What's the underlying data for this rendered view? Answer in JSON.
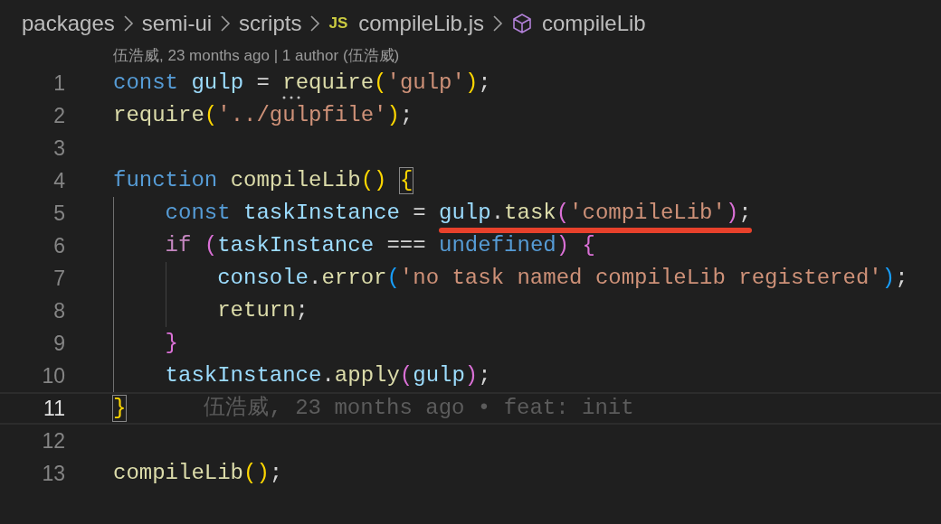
{
  "breadcrumbs": [
    {
      "label": "packages",
      "kind": "folder"
    },
    {
      "label": "semi-ui",
      "kind": "folder"
    },
    {
      "label": "scripts",
      "kind": "folder"
    },
    {
      "label": "compileLib.js",
      "kind": "file",
      "badge": "JS"
    },
    {
      "label": "compileLib",
      "kind": "symbol"
    }
  ],
  "codelens": "伍浩威, 23 months ago | 1 author (伍浩威)",
  "lines": [
    {
      "number": "1",
      "current": false,
      "tokens": [
        {
          "t": "const ",
          "color": "#569cd6"
        },
        {
          "t": "gulp",
          "color": "#9cdcfe"
        },
        {
          "t": " = ",
          "color": "#d4d4d4"
        },
        {
          "t": "require",
          "color": "#dcdcaa",
          "hint": true
        },
        {
          "t": "(",
          "color": "#ffd700"
        },
        {
          "t": "'gulp'",
          "color": "#ce9178"
        },
        {
          "t": ")",
          "color": "#ffd700"
        },
        {
          "t": ";",
          "color": "#d4d4d4"
        }
      ]
    },
    {
      "number": "2",
      "current": false,
      "tokens": [
        {
          "t": "require",
          "color": "#dcdcaa"
        },
        {
          "t": "(",
          "color": "#ffd700"
        },
        {
          "t": "'../gulpfile'",
          "color": "#ce9178"
        },
        {
          "t": ")",
          "color": "#ffd700"
        },
        {
          "t": ";",
          "color": "#d4d4d4"
        }
      ]
    },
    {
      "number": "3",
      "current": false
    },
    {
      "number": "4",
      "current": false,
      "tokens": [
        {
          "t": "function ",
          "color": "#569cd6"
        },
        {
          "t": "compileLib",
          "color": "#dcdcaa"
        },
        {
          "t": "() ",
          "color": "#ffd700"
        },
        {
          "t": "{",
          "color": "#ffd700",
          "matched": true
        }
      ],
      "children": [
        {
          "number": "5",
          "current": false,
          "tokens": [
            {
              "t": "const ",
              "color": "#569cd6"
            },
            {
              "t": "taskInstance",
              "color": "#9cdcfe"
            },
            {
              "t": " = ",
              "color": "#d4d4d4"
            },
            {
              "underlined": true,
              "tokens": [
                {
                  "t": "gulp",
                  "color": "#9cdcfe"
                },
                {
                  "t": ".",
                  "color": "#d4d4d4"
                },
                {
                  "t": "task",
                  "color": "#dcdcaa"
                },
                {
                  "t": "(",
                  "color": "#da70d6"
                },
                {
                  "t": "'compileLib'",
                  "color": "#ce9178"
                },
                {
                  "t": ")",
                  "color": "#da70d6"
                },
                {
                  "t": ";",
                  "color": "#d4d4d4"
                }
              ]
            }
          ]
        },
        {
          "number": "6",
          "current": false,
          "tokens": [
            {
              "t": "if ",
              "color": "#c586c0"
            },
            {
              "t": "(",
              "color": "#da70d6"
            },
            {
              "t": "taskInstance",
              "color": "#9cdcfe"
            },
            {
              "t": " === ",
              "color": "#d4d4d4"
            },
            {
              "t": "undefined",
              "color": "#569cd6"
            },
            {
              "t": ")",
              "color": "#da70d6"
            },
            {
              "t": " {",
              "color": "#da70d6"
            }
          ],
          "children": [
            {
              "number": "7",
              "current": false,
              "tokens": [
                {
                  "t": "console",
                  "color": "#9cdcfe"
                },
                {
                  "t": ".",
                  "color": "#d4d4d4"
                },
                {
                  "t": "error",
                  "color": "#dcdcaa"
                },
                {
                  "t": "(",
                  "color": "#179fff"
                },
                {
                  "t": "'no task named compileLib registered'",
                  "color": "#ce9178"
                },
                {
                  "t": ")",
                  "color": "#179fff"
                },
                {
                  "t": ";",
                  "color": "#d4d4d4"
                }
              ]
            },
            {
              "number": "8",
              "current": false,
              "tokens": [
                {
                  "t": "return",
                  "color": "#dcdcaa"
                },
                {
                  "t": ";",
                  "color": "#d4d4d4"
                }
              ]
            }
          ]
        },
        {
          "number": "9",
          "current": false,
          "tokens": [
            {
              "t": "}",
              "color": "#da70d6"
            }
          ]
        },
        {
          "number": "10",
          "current": false,
          "tokens": [
            {
              "t": "taskInstance",
              "color": "#9cdcfe"
            },
            {
              "t": ".",
              "color": "#d4d4d4"
            },
            {
              "t": "apply",
              "color": "#dcdcaa"
            },
            {
              "t": "(",
              "color": "#da70d6"
            },
            {
              "t": "gulp",
              "color": "#9cdcfe"
            },
            {
              "t": ")",
              "color": "#da70d6"
            },
            {
              "t": ";",
              "color": "#d4d4d4"
            }
          ]
        }
      ]
    },
    {
      "number": "11",
      "current": true,
      "tokens": [
        {
          "t": "}",
          "color": "#ffd700",
          "matched": true
        }
      ],
      "blame": "伍浩威, 23 months ago • feat: init"
    },
    {
      "number": "12",
      "current": false
    },
    {
      "number": "13",
      "current": false,
      "tokens": [
        {
          "t": "compileLib",
          "color": "#dcdcaa"
        },
        {
          "t": "()",
          "color": "#ffd700"
        },
        {
          "t": ";",
          "color": "#d4d4d4"
        }
      ]
    }
  ]
}
